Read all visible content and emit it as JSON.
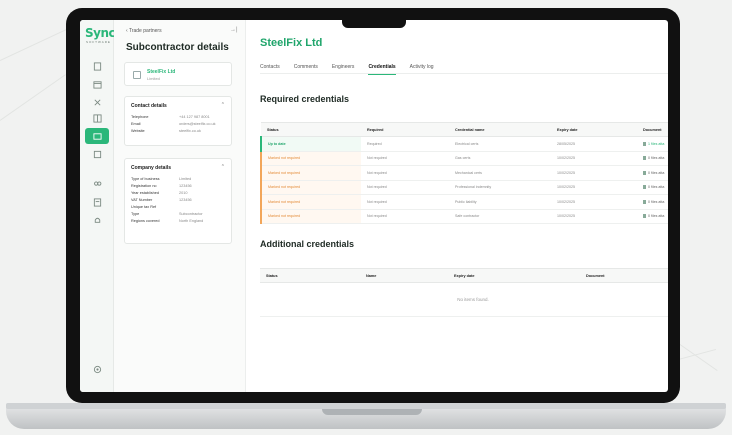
{
  "logo": {
    "text": "Sync",
    "sub": "SOFTWARE"
  },
  "nav_icons": [
    "document-icon",
    "calendar-icon",
    "tools-icon",
    "grid-icon",
    "partners-icon",
    "list-icon",
    "people-icon",
    "notes-icon",
    "bell-icon",
    "settings-icon"
  ],
  "panel": {
    "breadcrumb": "‹  Trade partners",
    "collapse_icon": "→|",
    "title": "Subcontractor details",
    "company_name": "SteelFix Ltd",
    "company_sub": "Limited",
    "contact": {
      "heading": "Contact details",
      "rows": [
        {
          "k": "Telephone",
          "v": "+44 127 987 8001"
        },
        {
          "k": "Email",
          "v": "orders@steelfix.co.uk"
        },
        {
          "k": "Website",
          "v": "steelfix.co.uk"
        }
      ]
    },
    "company": {
      "heading": "Company details",
      "rows": [
        {
          "k": "Type of business",
          "v": "Limited"
        },
        {
          "k": "Registration no",
          "v": "123456"
        },
        {
          "k": "Year established",
          "v": "2010"
        },
        {
          "k": "VAT Number",
          "v": "123456"
        },
        {
          "k": "Unique tax Ref",
          "v": ""
        },
        {
          "k": "Type",
          "v": "Subcontractor"
        },
        {
          "k": "Regions covered",
          "v": "North England"
        }
      ]
    }
  },
  "main": {
    "title": "SteelFix Ltd",
    "tabs": [
      "Contacts",
      "Comments",
      "Engineers",
      "Credentials",
      "Activity log"
    ],
    "active_tab": 3,
    "required_title": "Required credentials",
    "required_headers": [
      "Status",
      "Required",
      "Credential name",
      "Expiry date",
      "Document"
    ],
    "required_rows": [
      {
        "status": "Up to date",
        "ok": true,
        "required": "Required",
        "name": "Electrical certs",
        "expiry": "28/05/2025",
        "doc": "1 files atta"
      },
      {
        "status": "Marked not required",
        "ok": false,
        "required": "Not required",
        "name": "Gas certs",
        "expiry": "10/02/2025",
        "doc": "0 files atta"
      },
      {
        "status": "Marked not required",
        "ok": false,
        "required": "Not required",
        "name": "Mechanical certs",
        "expiry": "10/02/2025",
        "doc": "0 files atta"
      },
      {
        "status": "Marked not required",
        "ok": false,
        "required": "Not required",
        "name": "Professional indemnity",
        "expiry": "10/02/2025",
        "doc": "0 files atta"
      },
      {
        "status": "Marked not required",
        "ok": false,
        "required": "Not required",
        "name": "Public liability",
        "expiry": "10/02/2025",
        "doc": "0 files atta"
      },
      {
        "status": "Marked not required",
        "ok": false,
        "required": "Not required",
        "name": "Safe contractor",
        "expiry": "10/02/2025",
        "doc": "0 files atta"
      }
    ],
    "additional_title": "Additional credentials",
    "additional_headers": [
      "Status",
      "Name",
      "Expiry date",
      "Document"
    ],
    "empty_text": "No items found."
  },
  "colors": {
    "accent": "#2bb77a",
    "warning": "#e38a35"
  }
}
